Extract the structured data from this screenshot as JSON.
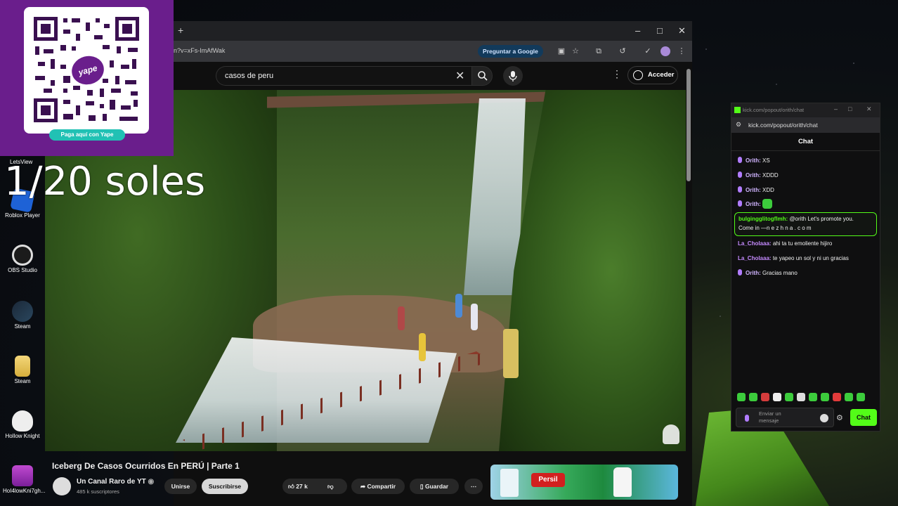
{
  "overlay": {
    "qr_caption": "Paga aquí con Yape",
    "yape_logo": "yape",
    "price_text": "1/20 soles",
    "lets_view_label": "LetsView"
  },
  "desktop": {
    "icons": [
      {
        "label": "Roblox Player",
        "icon": "roblox-icon"
      },
      {
        "label": "OBS Studio",
        "icon": "obs-icon"
      },
      {
        "label": "Steam",
        "icon": "steam-icon"
      },
      {
        "label": "Steam",
        "icon": "folder-icon"
      },
      {
        "label": "Hollow Knight",
        "icon": "hollow-knight-icon"
      },
      {
        "label": "HoI4lowKni7gh...",
        "icon": "winrar-icon"
      }
    ]
  },
  "browser": {
    "new_tab": "+",
    "window_controls": {
      "minimize": "–",
      "maximize": "□",
      "close": "✕"
    },
    "url": "n?v=xFs-ImAfWak",
    "ask_google": "Preguntar a Google"
  },
  "youtube": {
    "search_value": "casos de peru",
    "sign_in": "Acceder",
    "video_title": "Iceberg De Casos Ocurridos En PERÚ | Parte 1",
    "channel_name": "Un Canal Raro de YT",
    "channel_subs": "485 k suscriptores",
    "join_label": "Unirse",
    "subscribe_label": "Suscribirse",
    "like_count": "27 k",
    "share_label": "Compartir",
    "save_label": "Guardar",
    "ad_brand": "Persil"
  },
  "kick": {
    "window_title": "kick.com/popout/orith/chat",
    "address": "kick.com/popout/orith/chat",
    "header": "Chat",
    "messages": [
      {
        "user": "Orith:",
        "text": "XS"
      },
      {
        "user": "Orith:",
        "text": "XDDD"
      },
      {
        "user": "Orith:",
        "text": "XDD"
      },
      {
        "user": "Orith:",
        "text": ""
      },
      {
        "user": "bulgingglitogflmh:",
        "text": "@orith Let's promote you.",
        "text2": "Come in —n e z h n a . c o m"
      },
      {
        "user": "La_Cholaaa:",
        "text": "ahi ta tu emoliente hijiro"
      },
      {
        "user": "La_Cholaaa:",
        "text": "te yapeo un sol y ni un gracias"
      },
      {
        "user": "Orith:",
        "text": "Gracias mano"
      }
    ],
    "input_placeholder": "Enviar un mensaje",
    "send_label": "Chat"
  },
  "colors": {
    "kick_green": "#53fc18",
    "yape_purple": "#6a1e8c",
    "yt_bg": "#0f0f0f"
  }
}
